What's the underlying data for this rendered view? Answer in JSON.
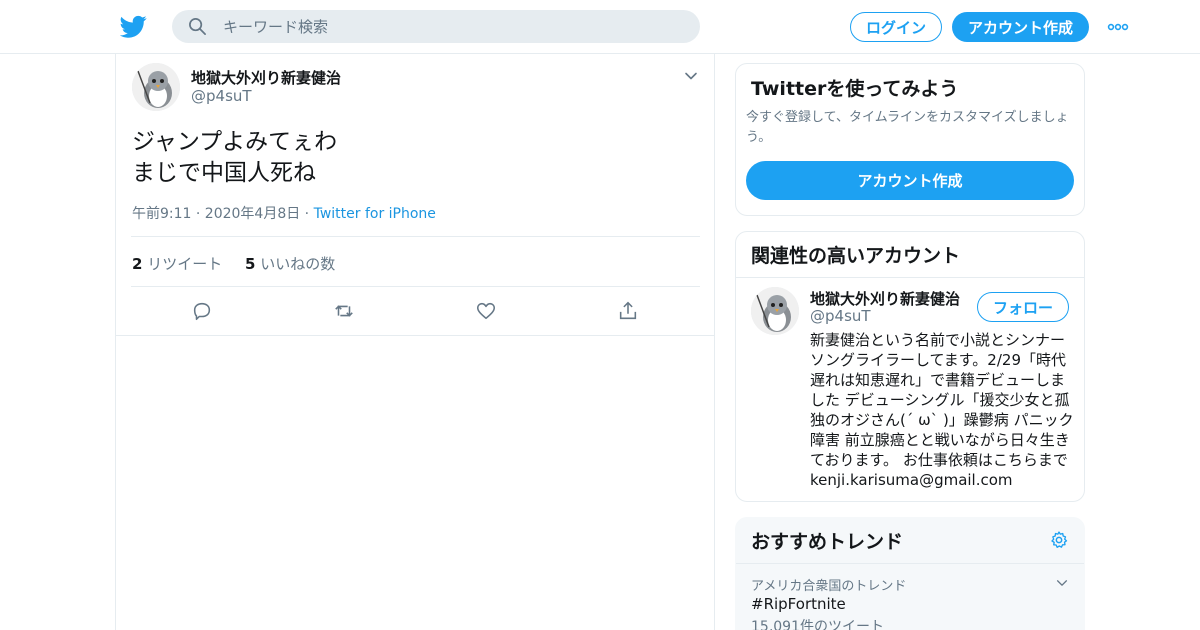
{
  "colors": {
    "accent": "#1da1f2",
    "link": "#1b95e0",
    "muted": "#657786",
    "border": "#e6ecf0"
  },
  "header": {
    "logo_icon": "twitter-bird-icon",
    "search_placeholder": "キーワード検索",
    "login_label": "ログイン",
    "signup_label": "アカウント作成",
    "more_icon": "more-dots-icon"
  },
  "tweet": {
    "author_name": "地獄大外刈り新妻健治",
    "author_handle": "@p4suT",
    "text_lines": [
      "ジャンプよみてぇわ",
      "まじで中国人死ね"
    ],
    "timestamp": "午前9:11 · 2020年4月8日",
    "separator": " · ",
    "source": "Twitter for iPhone",
    "retweet_count": "2",
    "retweet_label": "リツイート",
    "like_count": "5",
    "like_label": "いいねの数"
  },
  "signup_module": {
    "title": "Twitterを使ってみよう",
    "description": "今すぐ登録して、タイムラインをカスタマイズしましょう。",
    "button_label": "アカウント作成"
  },
  "related_module": {
    "title": "関連性の高いアカウント",
    "name": "地獄大外刈り新妻健治",
    "handle": "@p4suT",
    "follow_label": "フォロー",
    "bio": "新妻健治という名前で小説とシンナーソングライラーしてます。2/29「時代遅れは知恵遅れ」で書籍デビューしました デビューシングル「援交少女と孤独のオジさん(´ ω` )」躁鬱病 パニック障害 前立腺癌とと戦いながら日々生きております。 お仕事依頼はこちらまで kenji.karisuma@gmail.com"
  },
  "trends_module": {
    "title": "おすすめトレンド",
    "location": "アメリカ合衆国のトレンド",
    "tag": "#RipFortnite",
    "count": "15,091件のツイート"
  }
}
